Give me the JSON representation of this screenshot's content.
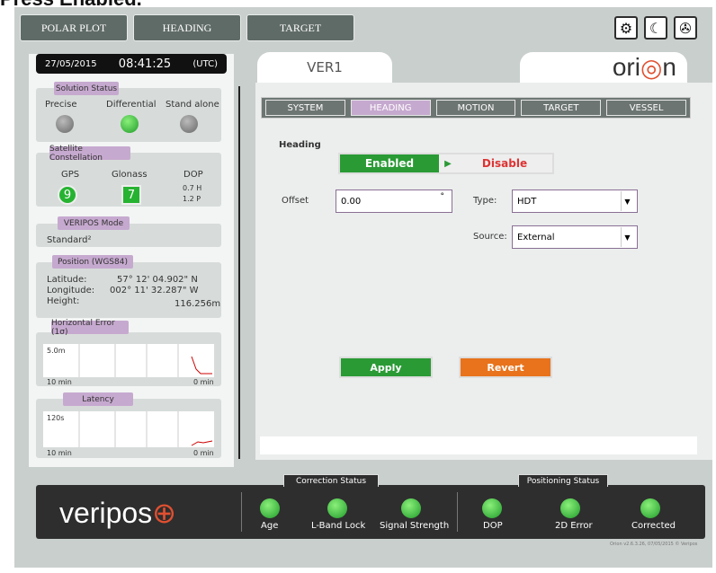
{
  "caption": "Press Enabled.",
  "topnav": {
    "items": [
      "POLAR PLOT",
      "HEADING",
      "TARGET"
    ]
  },
  "clock": {
    "date": "27/05/2015",
    "time": "08:41:25",
    "zone": "(UTC)"
  },
  "solution": {
    "label": "Solution Status",
    "modes": [
      "Precise",
      "Differential",
      "Stand alone"
    ]
  },
  "satellite": {
    "label": "Satellite Constellation",
    "headers": [
      "GPS",
      "Glonass",
      "DOP"
    ],
    "gps": "9",
    "glonass": "7",
    "dop_h": "0.7 H",
    "dop_p": "1.2 P"
  },
  "veripos_mode": {
    "label": "VERIPOS Mode",
    "value": "Standard²"
  },
  "position": {
    "label": "Position (WGS84)",
    "rows": [
      {
        "k": "Latitude:",
        "v": "57° 12' 04.902\" N"
      },
      {
        "k": "Longitude:",
        "v": "002° 11' 32.287\" W"
      },
      {
        "k": "Height:",
        "v": "116.256m"
      }
    ]
  },
  "herr": {
    "label": "Horizontal Error (1σ)",
    "y": "5.0m",
    "x0": "10 min",
    "x1": "0 min"
  },
  "latency": {
    "label": "Latency",
    "y": "120s",
    "x0": "10 min",
    "x1": "0 min"
  },
  "tabs": {
    "ver": "VER1",
    "logo_pre": "ori",
    "logo_post": "n"
  },
  "subtabs": [
    "SYSTEM",
    "HEADING",
    "MOTION",
    "TARGET",
    "VESSEL"
  ],
  "heading": {
    "title": "Heading",
    "enabled": "Enabled",
    "disable": "Disable",
    "offset_label": "Offset",
    "offset": "0.00",
    "deg": "°",
    "type_label": "Type:",
    "type": "HDT",
    "source_label": "Source:",
    "source": "External"
  },
  "actions": {
    "apply": "Apply",
    "revert": "Revert"
  },
  "status": {
    "correction": "Correction Status",
    "positioning": "Positioning Status",
    "items": [
      "Age",
      "L-Band Lock",
      "Signal Strength",
      "DOP",
      "2D Error",
      "Corrected"
    ],
    "brand": "veripos",
    "version": "Orion v2.6.3.26, 07/05/2015 © Veripos"
  },
  "colors": {
    "accent": "#c6a9cf",
    "ok": "#26b331",
    "dark": "#2e2e2e"
  }
}
